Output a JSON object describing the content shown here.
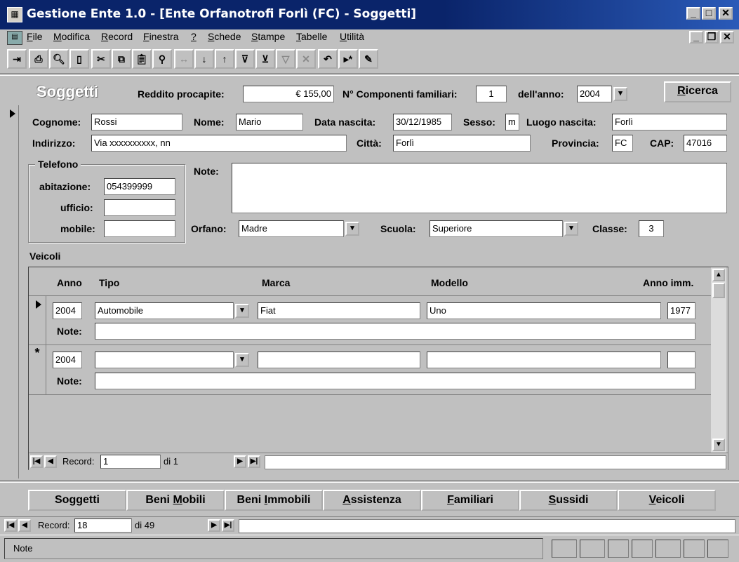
{
  "window": {
    "title": "Gestione Ente 1.0 - [Ente Orfanotrofi Forlì (FC) - Soggetti]"
  },
  "menu": [
    "File",
    "Modifica",
    "Record",
    "Finestra",
    "?",
    "Schede",
    "Stampe",
    "Tabelle",
    "Utilità"
  ],
  "toolbar_icons": [
    "exit-icon",
    "print-icon",
    "preview-icon",
    "new-doc-icon",
    "cut-icon",
    "copy-icon",
    "paste-icon",
    "find-icon",
    "replace-icon",
    "sort-asc-icon",
    "sort-desc-icon",
    "filter-selection-icon",
    "filter-form-icon",
    "apply-filter-icon",
    "remove-filter-icon",
    "undo-icon",
    "new-record-icon",
    "edit-icon"
  ],
  "header": {
    "form_title": "Soggetti",
    "reddito_label": "Reddito procapite:",
    "reddito_value": "€ 155,00",
    "componenti_label": "N° Componenti familiari:",
    "componenti_value": "1",
    "anno_label": "dell'anno:",
    "anno_value": "2004",
    "ricerca_button": "Ricerca"
  },
  "person": {
    "cognome_label": "Cognome:",
    "cognome": "Rossi",
    "nome_label": "Nome:",
    "nome": "Mario",
    "data_nascita_label": "Data nascita:",
    "data_nascita": "30/12/1985",
    "sesso_label": "Sesso:",
    "sesso": "m",
    "luogo_nascita_label": "Luogo nascita:",
    "luogo_nascita": "Forlì",
    "indirizzo_label": "Indirizzo:",
    "indirizzo": "Via xxxxxxxxxx, nn",
    "citta_label": "Città:",
    "citta": "Forlì",
    "provincia_label": "Provincia:",
    "provincia": "FC",
    "cap_label": "CAP:",
    "cap": "47016"
  },
  "telefono": {
    "group_label": "Telefono",
    "abitazione_label": "abitazione:",
    "abitazione": "054399999",
    "ufficio_label": "ufficio:",
    "ufficio": "",
    "mobile_label": "mobile:",
    "mobile": ""
  },
  "note_label": "Note:",
  "note": "",
  "orfano_label": "Orfano:",
  "orfano": "Madre",
  "scuola_label": "Scuola:",
  "scuola": "Superiore",
  "classe_label": "Classe:",
  "classe": "3",
  "veicoli": {
    "section_label": "Veicoli",
    "columns": {
      "anno": "Anno",
      "tipo": "Tipo",
      "marca": "Marca",
      "modello": "Modello",
      "anno_imm": "Anno imm."
    },
    "note_label": "Note:",
    "rows": [
      {
        "anno": "2004",
        "tipo": "Automobile",
        "marca": "Fiat",
        "modello": "Uno",
        "anno_imm": "1977",
        "note": ""
      },
      {
        "anno": "2004",
        "tipo": "",
        "marca": "",
        "modello": "",
        "anno_imm": "",
        "note": ""
      }
    ],
    "nav": {
      "record_label": "Record:",
      "current": "1",
      "of": "di 1"
    }
  },
  "tabs": [
    {
      "label": "Soggetti",
      "ul": ""
    },
    {
      "label": "Beni Mobili",
      "ul": "M"
    },
    {
      "label": "Beni Immobili",
      "ul": "I"
    },
    {
      "label": "Assistenza",
      "ul": "A"
    },
    {
      "label": "Familiari",
      "ul": "F"
    },
    {
      "label": "Sussidi",
      "ul": "S"
    },
    {
      "label": "Veicoli",
      "ul": "V"
    }
  ],
  "main_nav": {
    "record_label": "Record:",
    "current": "18",
    "of": "di 49"
  },
  "status": {
    "text": "Note"
  }
}
